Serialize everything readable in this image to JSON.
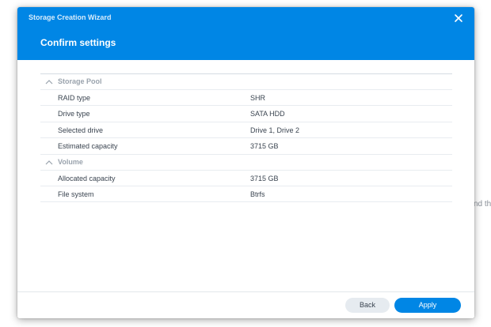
{
  "background": {
    "partial_text": "nd th"
  },
  "dialog": {
    "window_title": "Storage Creation Wizard",
    "close_icon": "close-icon",
    "step_title": "Confirm settings",
    "accent_color": "#0086e5"
  },
  "sections": [
    {
      "title": "Storage Pool",
      "icon": "chevron-up-icon",
      "rows": [
        {
          "label": "RAID type",
          "value": "SHR"
        },
        {
          "label": "Drive type",
          "value": "SATA HDD"
        },
        {
          "label": "Selected drive",
          "value": "Drive 1, Drive 2"
        },
        {
          "label": "Estimated capacity",
          "value": "3715 GB"
        }
      ]
    },
    {
      "title": "Volume",
      "icon": "chevron-up-icon",
      "rows": [
        {
          "label": "Allocated capacity",
          "value": "3715 GB"
        },
        {
          "label": "File system",
          "value": "Btrfs"
        }
      ]
    }
  ],
  "footer": {
    "back_label": "Back",
    "apply_label": "Apply"
  }
}
